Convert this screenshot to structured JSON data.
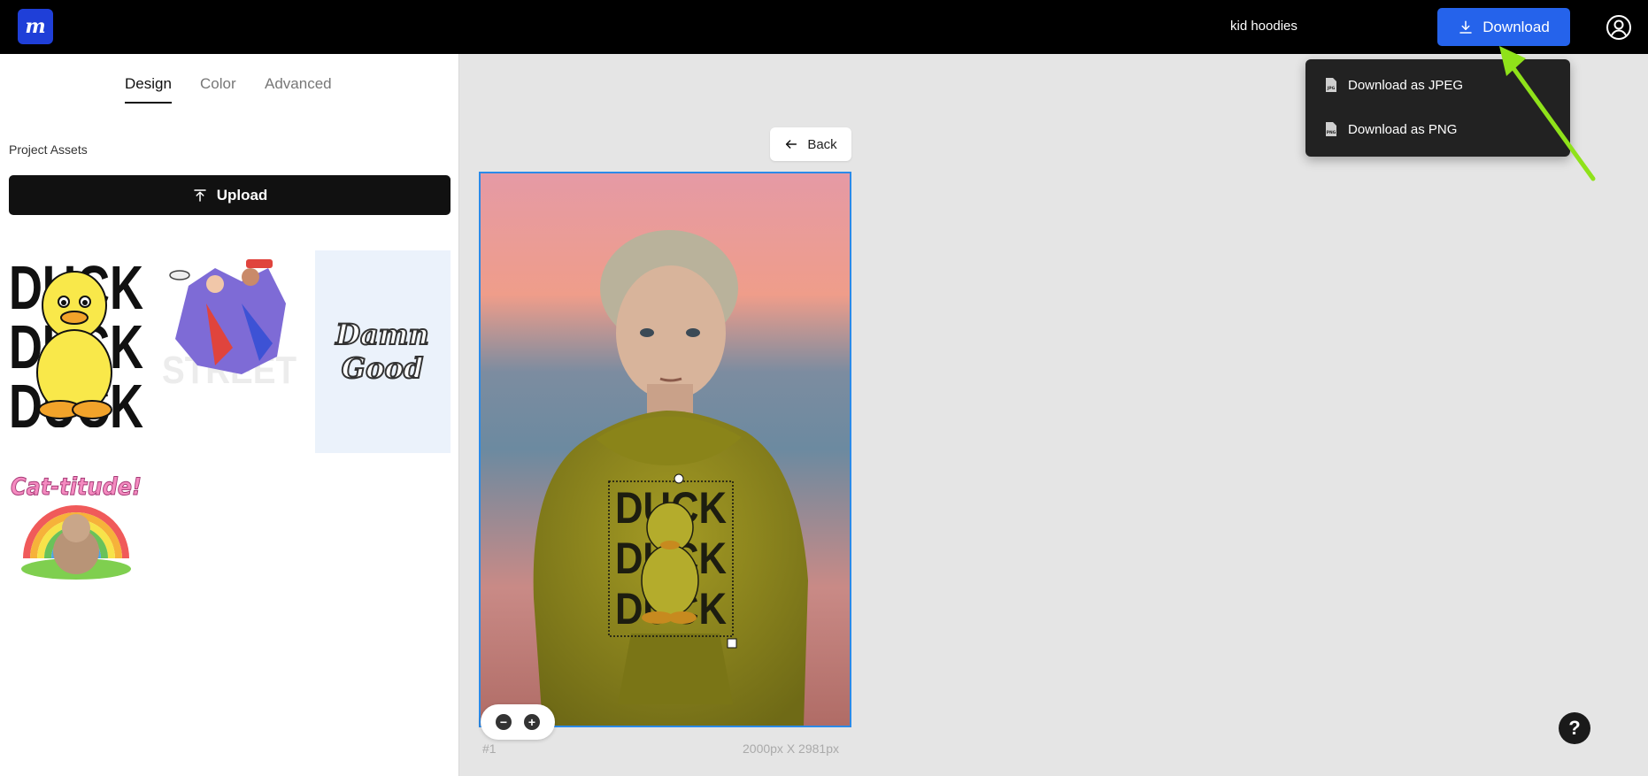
{
  "header": {
    "logo_letter": "m",
    "project_title": "kid hoodies",
    "download_label": "Download"
  },
  "tabs": [
    {
      "label": "Design",
      "active": true
    },
    {
      "label": "Color",
      "active": false
    },
    {
      "label": "Advanced",
      "active": false
    }
  ],
  "assets": {
    "section_title": "Project Assets",
    "upload_label": "Upload",
    "items": [
      {
        "name": "duck-duck-duck",
        "text_lines": [
          "DUCK",
          "DUCK",
          "DUCK"
        ]
      },
      {
        "name": "street-characters",
        "text": "STREET"
      },
      {
        "name": "damn-good",
        "text_lines": [
          "Damn",
          "Good"
        ]
      },
      {
        "name": "cat-titude",
        "text": "Cat-titude!"
      }
    ]
  },
  "canvas": {
    "back_label": "Back",
    "page_number": "#1",
    "dimensions": "2000px X 2981px",
    "design_text": [
      "DUCK",
      "DUCK",
      "DUCK"
    ]
  },
  "download_menu": {
    "items": [
      {
        "label": "Download as JPEG",
        "icon_tag": "JPG"
      },
      {
        "label": "Download as PNG",
        "icon_tag": "PNG"
      }
    ]
  },
  "help_label": "?",
  "colors": {
    "topbar": "#000000",
    "accent": "#2563eb",
    "logo": "#1f3fd8",
    "hoodie": "#8f8a1c",
    "annotation_arrow": "#8fe21a"
  }
}
